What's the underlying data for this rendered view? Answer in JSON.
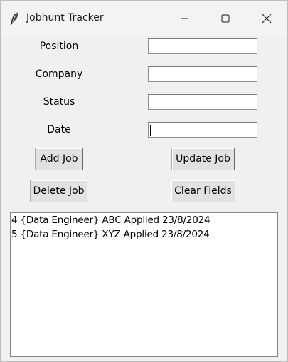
{
  "window": {
    "title": "Jobhunt Tracker",
    "icon": "feather-icon"
  },
  "controls": {
    "minimize_icon": "minimize-icon",
    "maximize_icon": "maximize-icon",
    "close_icon": "close-icon"
  },
  "form": {
    "position_label": "Position",
    "position_value": "",
    "company_label": "Company",
    "company_value": "",
    "status_label": "Status",
    "status_value": "",
    "date_label": "Date",
    "date_value": ""
  },
  "buttons": {
    "add_job": "Add Job",
    "update_job": "Update Job",
    "delete_job": "Delete Job",
    "clear_fields": "Clear Fields"
  },
  "jobs": [
    "4 {Data Engineer} ABC Applied 23/8/2024",
    "5 {Data Engineer} XYZ Applied 23/8/2024"
  ]
}
